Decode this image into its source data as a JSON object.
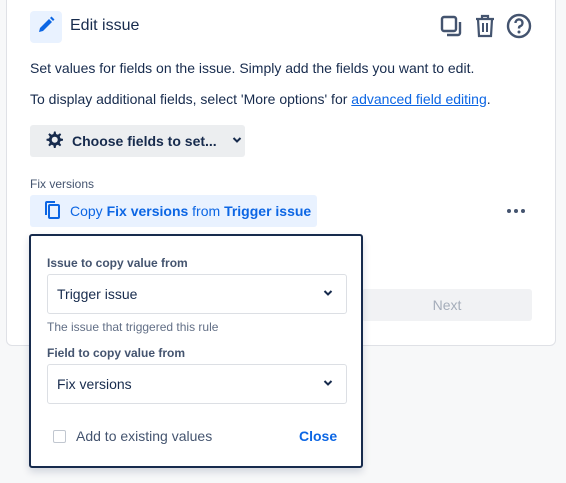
{
  "header": {
    "title": "Edit issue",
    "icons": [
      "pencil-icon",
      "duplicate-icon",
      "trash-icon",
      "help-icon"
    ]
  },
  "description": {
    "line1": "Set values for fields on the issue. Simply add the fields you want to edit.",
    "line2_prefix": "To display additional fields, select 'More options' for ",
    "line2_link": "advanced field editing",
    "line2_suffix": "."
  },
  "choose_fields": {
    "label": "Choose fields to set...",
    "icon": "gear-icon"
  },
  "fix_versions": {
    "label": "Fix versions",
    "copy_prefix": "Copy ",
    "copy_field": "Fix versions",
    "copy_middle": " from ",
    "copy_source": "Trigger issue"
  },
  "next_button": "Next",
  "popup": {
    "issue_label": "Issue to copy value from",
    "issue_value": "Trigger issue",
    "issue_help": "The issue that triggered this rule",
    "field_label": "Field to copy value from",
    "field_value": "Fix versions",
    "checkbox_label": "Add to existing values",
    "checkbox_checked": false,
    "close_label": "Close"
  },
  "colors": {
    "accent": "#0c66e4",
    "text": "#172b4d",
    "subtle": "#44546f"
  }
}
